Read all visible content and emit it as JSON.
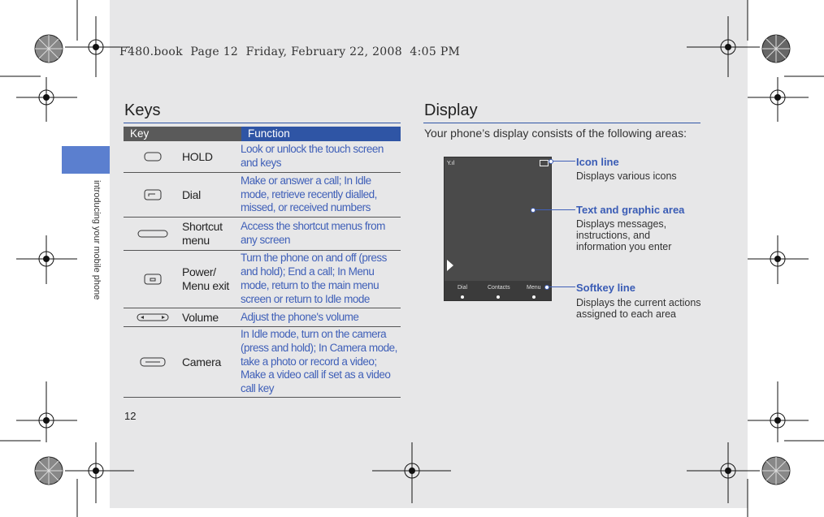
{
  "header": {
    "text": "F480.book  Page 12  Friday, February 22, 2008  4:05 PM"
  },
  "side_tab": {
    "text": "introducing your mobile phone"
  },
  "page_number": "12",
  "keys": {
    "title": "Keys",
    "col_key": "Key",
    "col_function": "Function",
    "rows": [
      {
        "icon": "hold-key-icon",
        "name": "HOLD",
        "function": "Look or unlock the touch screen and keys"
      },
      {
        "icon": "dial-key-icon",
        "name": "Dial",
        "function": "Make or answer a call; In Idle mode, retrieve recently dialled, missed, or received numbers"
      },
      {
        "icon": "shortcut-key-icon",
        "name": "Shortcut menu",
        "function": "Access the shortcut menus from any screen"
      },
      {
        "icon": "power-key-icon",
        "name": "Power/ Menu exit",
        "function": "Turn the phone on and off (press and hold); End a call; In Menu mode, return to the main menu screen or return to Idle mode"
      },
      {
        "icon": "volume-key-icon",
        "name": "Volume",
        "function": "Adjust the phone's volume"
      },
      {
        "icon": "camera-key-icon",
        "name": "Camera",
        "function": "In Idle mode, turn on the camera (press and hold); In Camera mode, take a photo or record a video; Make a video call if set as a video call key"
      }
    ]
  },
  "display": {
    "title": "Display",
    "intro": "Your phone’s display consists of the following areas:",
    "phone": {
      "softkeys": [
        "Dial",
        "Contacts",
        "Menu"
      ],
      "signal_label": "Y.ıl"
    },
    "callouts": [
      {
        "title": "Icon line",
        "desc": "Displays various icons"
      },
      {
        "title": "Text and graphic area",
        "desc": "Displays messages, instructions, and information you enter"
      },
      {
        "title": "Softkey line",
        "desc": "Displays the current actions assigned to each area"
      }
    ]
  },
  "colors": {
    "accent": "#2f55a5",
    "tab": "#5b7fcf",
    "link_text": "#4060b8",
    "page_bg": "#e7e7e8"
  }
}
